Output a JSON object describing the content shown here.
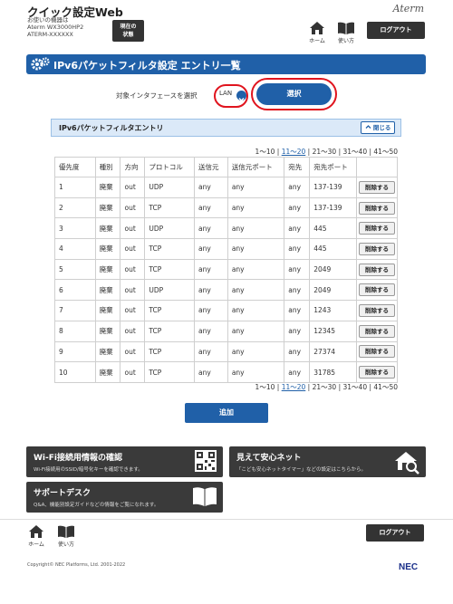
{
  "header": {
    "app_title": "クイック設定Web",
    "device_label": "お使いの機器は",
    "device_model": "Aterm  WX3000HP2",
    "device_id": "ATERM-XXXXXX",
    "status_button_line1": "現在の",
    "status_button_line2": "状態",
    "logo_text": "Aterm",
    "home_label": "ホーム",
    "manual_label": "使い方",
    "logout_label": "ログアウト"
  },
  "page": {
    "title": "IPv6パケットフィルタ設定 エントリ一覧"
  },
  "interface_select": {
    "label": "対象インタフェースを選択",
    "value": "LAN",
    "select_button": "選択"
  },
  "entries": {
    "section_title": "IPv6パケットフィルタエントリ",
    "collapse_label": "閉じる",
    "pager": {
      "p1": "1～10",
      "p2": "11～20",
      "p3": "21～30",
      "p4": "31～40",
      "p5": "41～50",
      "sep": "|"
    },
    "columns": [
      "優先度",
      "種別",
      "方向",
      "プロトコル",
      "送信元",
      "送信元ポート",
      "宛先",
      "宛先ポート"
    ],
    "rows": [
      [
        "1",
        "廃棄",
        "out",
        "UDP",
        "any",
        "any",
        "any",
        "137-139"
      ],
      [
        "2",
        "廃棄",
        "out",
        "TCP",
        "any",
        "any",
        "any",
        "137-139"
      ],
      [
        "3",
        "廃棄",
        "out",
        "UDP",
        "any",
        "any",
        "any",
        "445"
      ],
      [
        "4",
        "廃棄",
        "out",
        "TCP",
        "any",
        "any",
        "any",
        "445"
      ],
      [
        "5",
        "廃棄",
        "out",
        "TCP",
        "any",
        "any",
        "any",
        "2049"
      ],
      [
        "6",
        "廃棄",
        "out",
        "UDP",
        "any",
        "any",
        "any",
        "2049"
      ],
      [
        "7",
        "廃棄",
        "out",
        "TCP",
        "any",
        "any",
        "any",
        "1243"
      ],
      [
        "8",
        "廃棄",
        "out",
        "TCP",
        "any",
        "any",
        "any",
        "12345"
      ],
      [
        "9",
        "廃棄",
        "out",
        "TCP",
        "any",
        "any",
        "any",
        "27374"
      ],
      [
        "10",
        "廃棄",
        "out",
        "TCP",
        "any",
        "any",
        "any",
        "31785"
      ]
    ],
    "delete_label": "削除する",
    "add_label": "追加"
  },
  "tiles": {
    "wifi_title": "Wi-Fi接続用情報の確認",
    "wifi_desc": "Wi-Fi接続用のSSID/暗号化キーを確認できます。",
    "safe_title": "見えて安心ネット",
    "safe_desc": "「こども安心ネットタイマー」などの設定はこちらから。",
    "support_title": "サポートデスク",
    "support_desc": "Q&A、機能別設定ガイドなどの情報をご覧になれます。"
  },
  "footer": {
    "home_label": "ホーム",
    "manual_label": "使い方",
    "logout_label": "ログアウト",
    "copyright": "Copyright© NEC Platforms, Ltd. 2001-2022",
    "brand": "NEC"
  },
  "colors": {
    "primary_blue": "#2060a8",
    "highlight_red": "#e0141e",
    "dark_tile": "#3a3a3a"
  }
}
